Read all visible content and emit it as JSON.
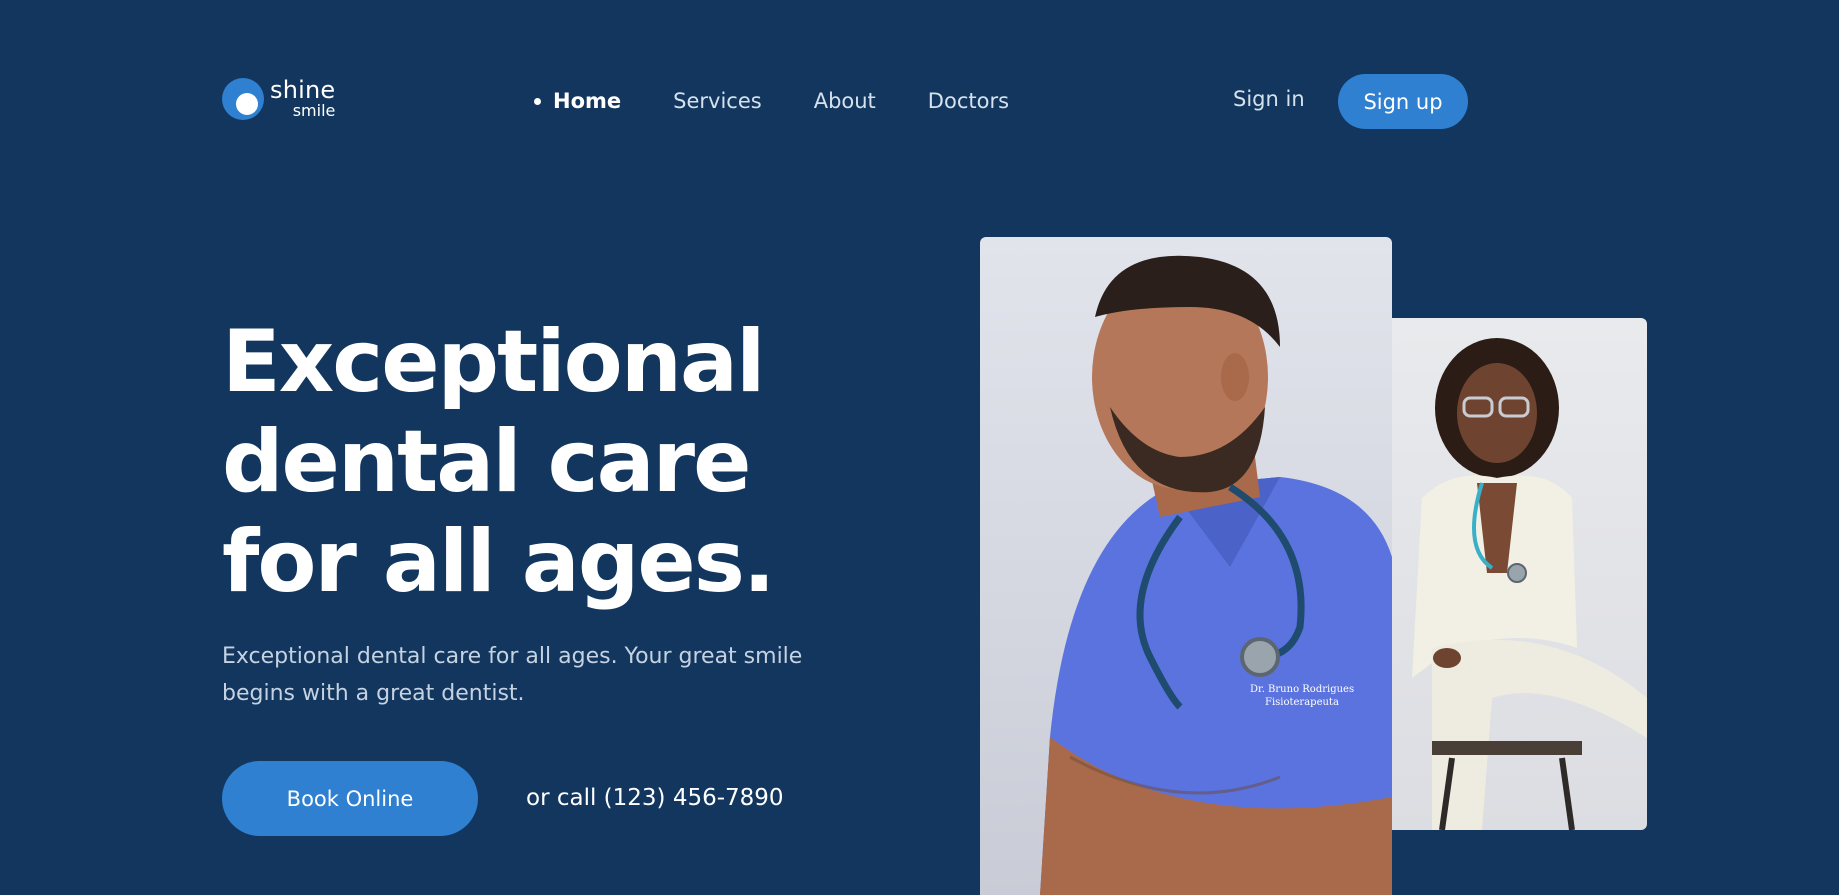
{
  "brand": {
    "name_line1": "shine",
    "name_line2": "smile"
  },
  "nav": {
    "items": [
      {
        "label": "Home",
        "active": true
      },
      {
        "label": "Services"
      },
      {
        "label": "About"
      },
      {
        "label": "Doctors"
      }
    ]
  },
  "auth": {
    "signin_label": "Sign in",
    "signup_label": "Sign up"
  },
  "hero": {
    "title": "Exceptional dental care for all ages.",
    "subtitle": "Exceptional dental care for all ages. Your great smile begins with a great dentist.",
    "cta_label": "Book Online",
    "call_prefix": "or call",
    "phone": "(123) 456-7890"
  },
  "photos": {
    "doctor_1_badge_line1": "Dr. Bruno Rodrigues",
    "doctor_1_badge_line2": "Fisioterapeuta"
  },
  "colors": {
    "background": "#12365d",
    "accent": "#2f80d1",
    "text": "#ffffff"
  }
}
